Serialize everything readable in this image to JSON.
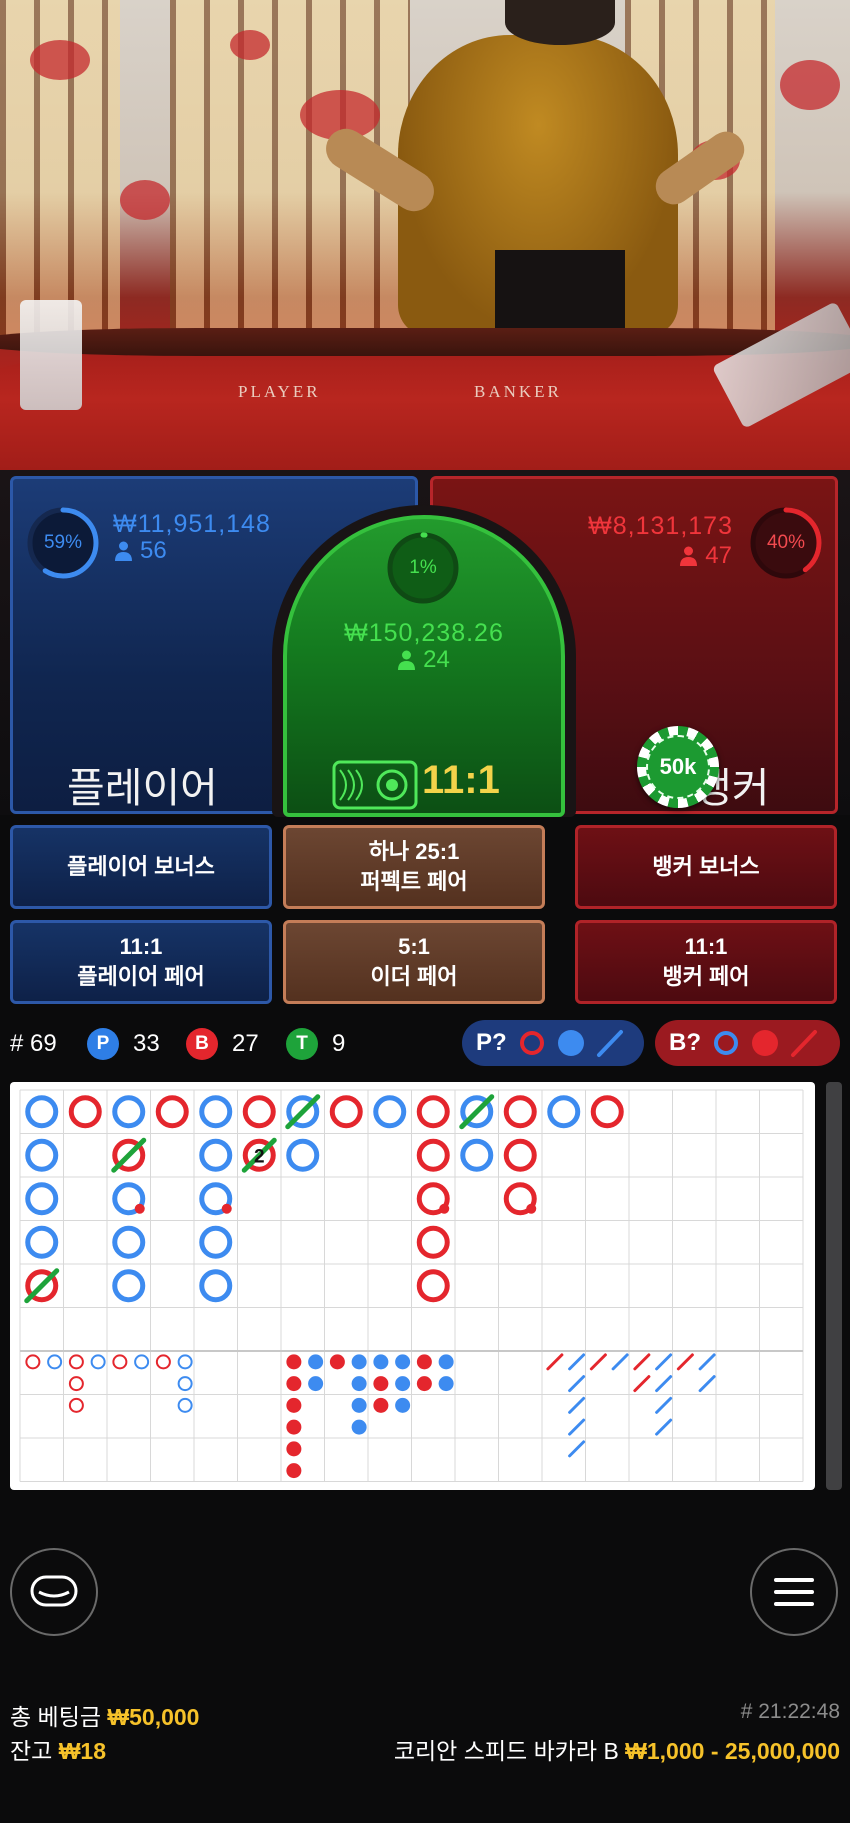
{
  "video": {
    "table_label_player": "PLAYER",
    "table_label_banker": "BANKER"
  },
  "player": {
    "percent": "59%",
    "percent_value": 59,
    "amount": "₩11,951,148",
    "count": "56",
    "name": "플레이어"
  },
  "tie": {
    "percent": "1%",
    "percent_value": 1,
    "amount": "₩150,238.26",
    "count": "24",
    "payout": "11:1"
  },
  "banker": {
    "percent": "40%",
    "percent_value": 40,
    "amount": "₩8,131,173",
    "count": "47",
    "name": "뱅커",
    "chip_label": "50k"
  },
  "side_bets": {
    "player_bonus": "플레이어 보너스",
    "perfect_pair_top": "하나 25:1",
    "perfect_pair_bottom": "퍼펙트 페어",
    "banker_bonus": "뱅커 보너스",
    "player_pair_top": "11:1",
    "player_pair_bottom": "플레이어 페어",
    "either_pair_top": "5:1",
    "either_pair_bottom": "이더 페어",
    "banker_pair_top": "11:1",
    "banker_pair_bottom": "뱅커 페어"
  },
  "stats": {
    "round_label": "# 69",
    "player_letter": "P",
    "player_count": "33",
    "banker_letter": "B",
    "banker_count": "27",
    "tie_letter": "T",
    "tie_count": "9",
    "player_ask": "P?",
    "banker_ask": "B?"
  },
  "bead_road": [
    [
      "B",
      "B",
      "B",
      "B",
      "T"
    ],
    [
      "R"
    ],
    [
      "B",
      "T",
      "Bp",
      "B",
      "B"
    ],
    [
      "R"
    ],
    [
      "B",
      "B",
      "Bp",
      "B",
      "B"
    ],
    [
      "R",
      "Rt2"
    ],
    [
      "Tb",
      "B"
    ],
    [
      "R"
    ],
    [
      "B"
    ],
    [
      "R",
      "R",
      "Rp",
      "R",
      "R"
    ],
    [
      "Tb",
      "B"
    ],
    [
      "R",
      "R",
      "Rp"
    ],
    [
      "B"
    ],
    [
      "R"
    ]
  ],
  "footer": {
    "total_bet_label": "총 베팅금",
    "total_bet_value": "₩50,000",
    "balance_label": "잔고",
    "balance_value": "₩18",
    "time": "# 21:22:48",
    "table_name": "코리안 스피드 바카라 B",
    "limits": "₩1,000 - 25,000,000"
  },
  "colors": {
    "player_blue": "#3d8bf0",
    "banker_red": "#e4262d",
    "tie_green": "#1ea33a",
    "gold": "#f6c22a"
  }
}
